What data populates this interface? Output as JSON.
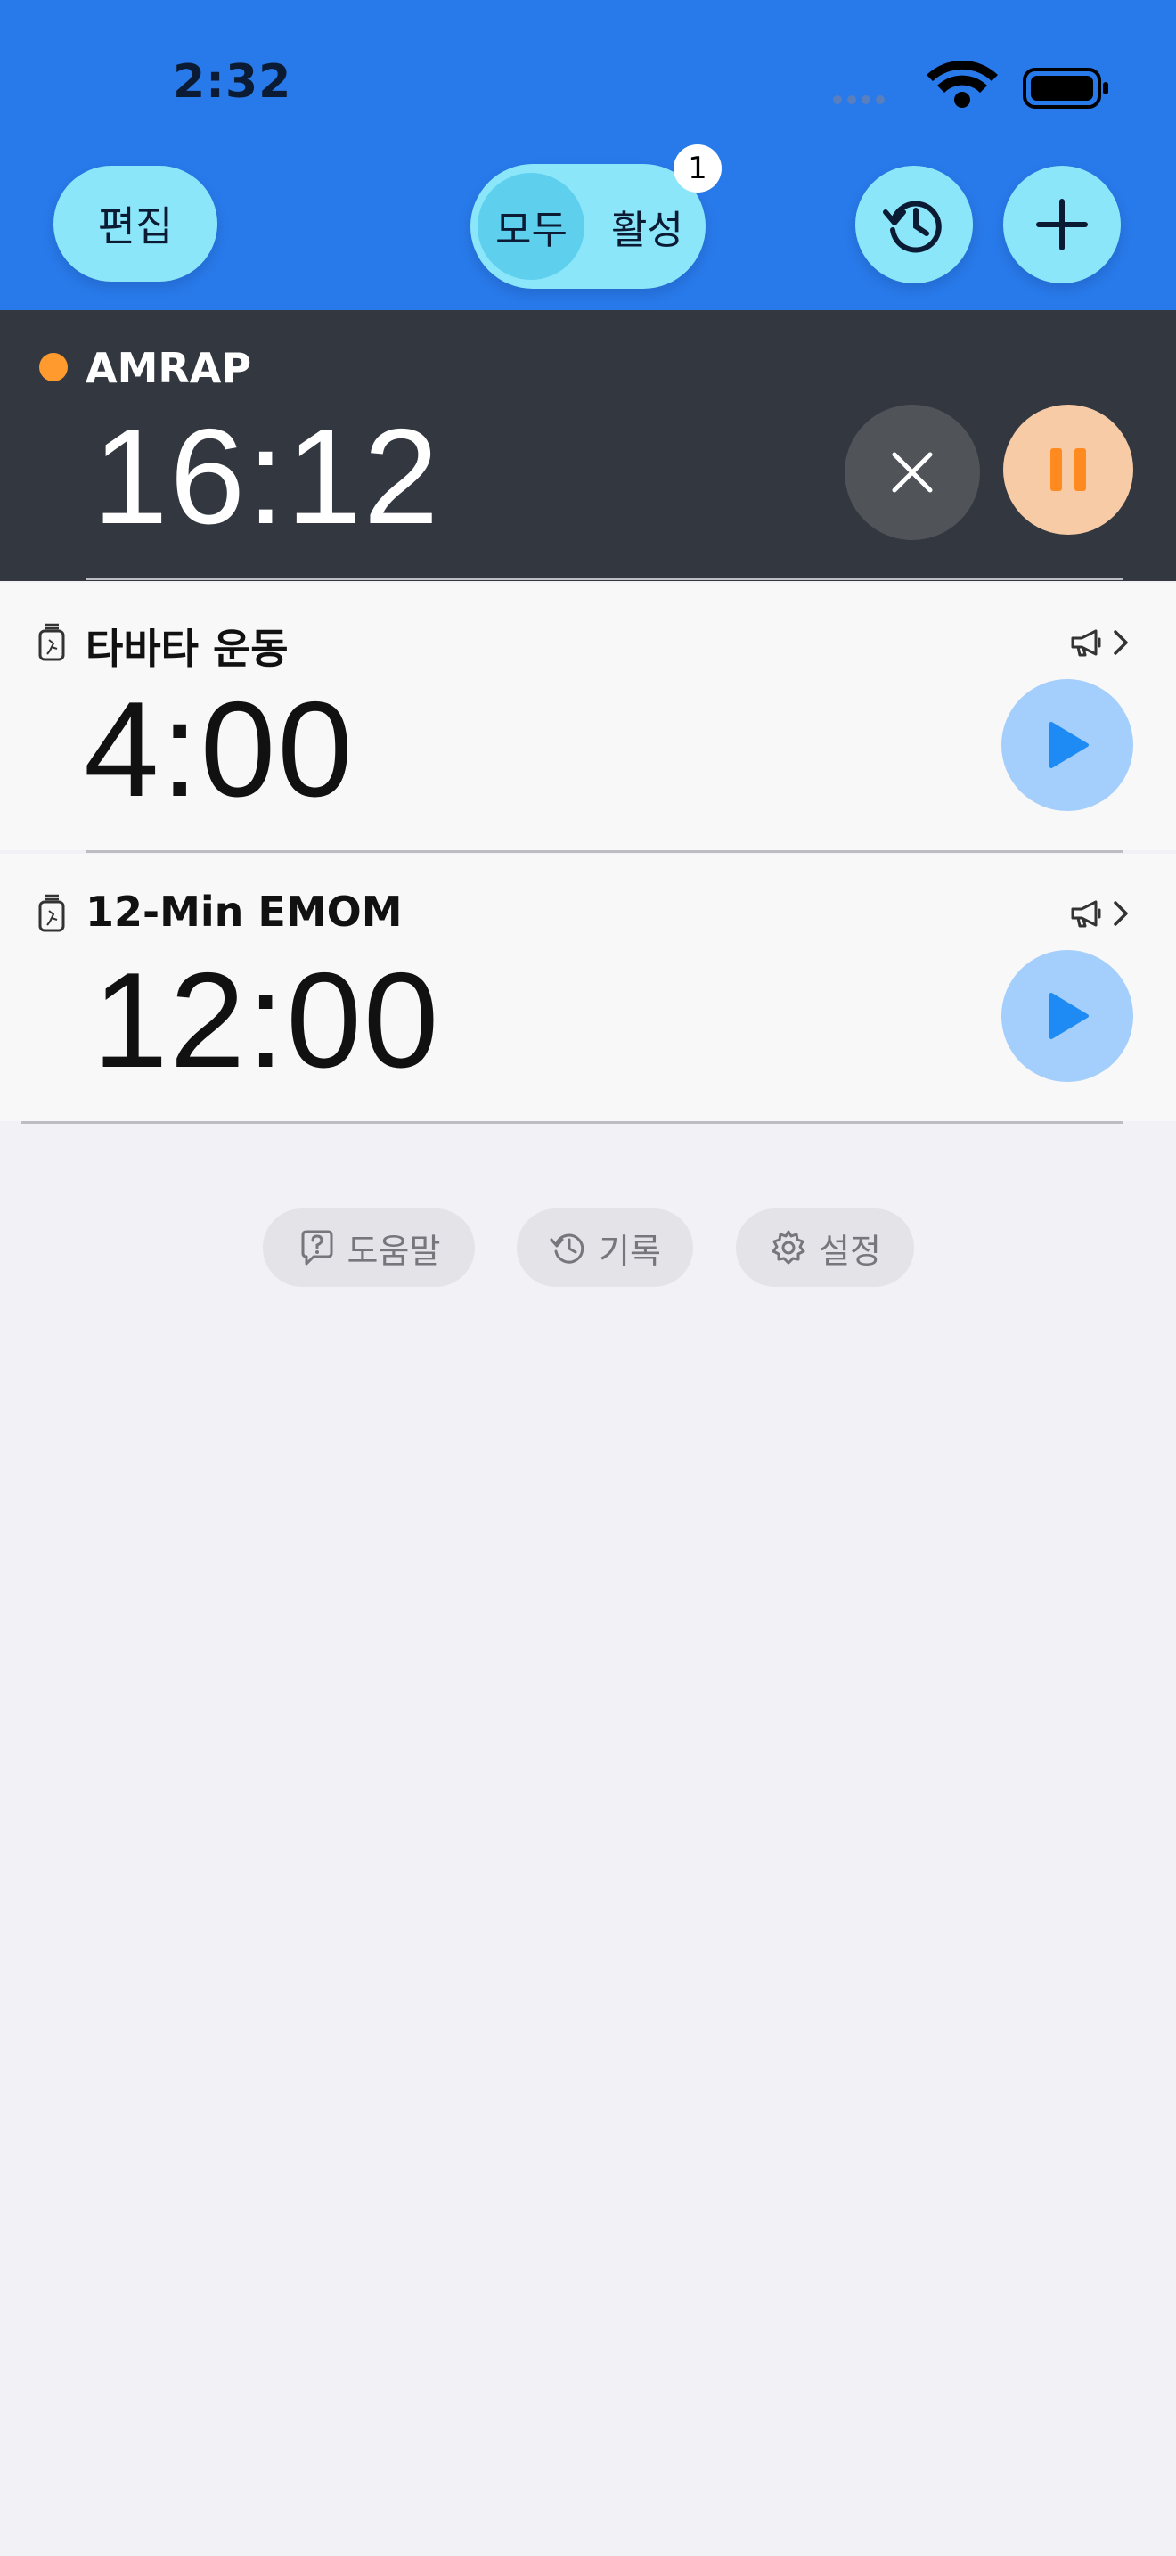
{
  "status_bar": {
    "time": "2:32"
  },
  "header": {
    "edit_label": "편집",
    "segment": {
      "all_label": "모두",
      "active_label": "활성",
      "selected": "모두",
      "active_count": "1"
    },
    "history_icon": "history-icon",
    "add_icon": "plus-icon"
  },
  "timers": [
    {
      "name": "AMRAP",
      "time": "16:12",
      "state": "running"
    },
    {
      "name": "타바타 운동",
      "time": "4:00",
      "state": "stopped"
    },
    {
      "name": "12-Min EMOM",
      "time": "12:00",
      "state": "stopped"
    }
  ],
  "footer": {
    "help_label": "도움말",
    "records_label": "기록",
    "settings_label": "설정"
  },
  "colors": {
    "header_bg": "#2879EA",
    "button_bg": "#8CE6FA",
    "active_row_bg": "#333840",
    "running_dot": "#FF9A2E",
    "pause_bg": "#F7CBA6",
    "play_bg": "#A4CEFB",
    "play_icon": "#1E8BF5"
  }
}
